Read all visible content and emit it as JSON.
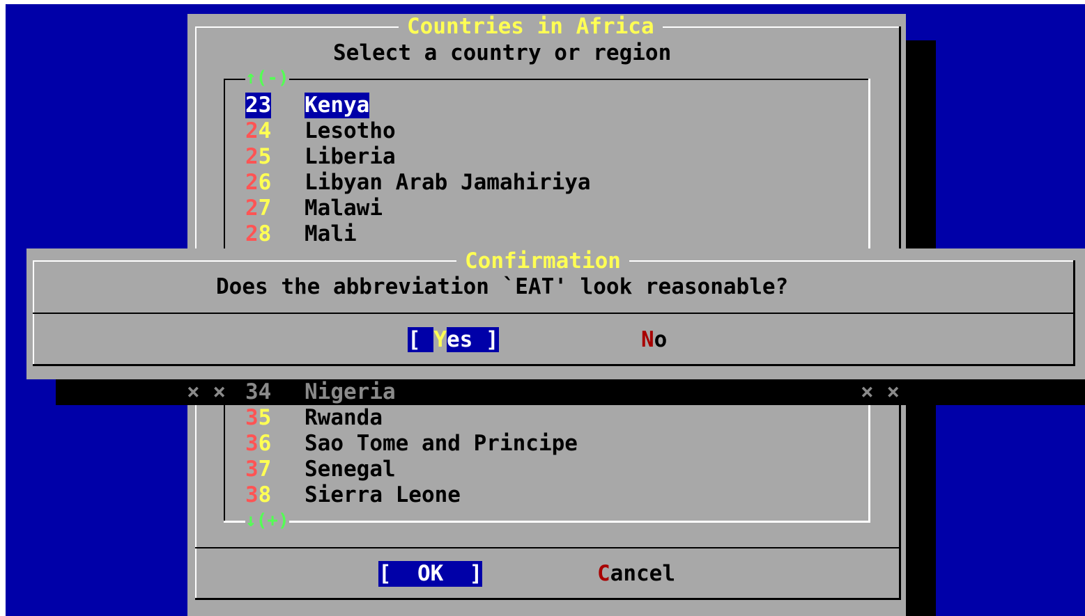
{
  "main_dialog": {
    "title": "Countries in Africa",
    "prompt": "Select a country or region",
    "scroll_up": "↑(-)",
    "scroll_down": "↓(+)",
    "items_top": [
      {
        "num": "23",
        "label": "Kenya"
      },
      {
        "num": "24",
        "label": "Lesotho"
      },
      {
        "num": "25",
        "label": "Liberia"
      },
      {
        "num": "26",
        "label": "Libyan Arab Jamahiriya"
      },
      {
        "num": "27",
        "label": "Malawi"
      },
      {
        "num": "28",
        "label": "Mali"
      }
    ],
    "shadowed_row": {
      "marks_left": "× ×",
      "num": "34",
      "label": "Nigeria",
      "marks_right": "× ×"
    },
    "items_bottom": [
      {
        "num": "35",
        "label": "Rwanda"
      },
      {
        "num": "36",
        "label": "Sao Tome and Principe"
      },
      {
        "num": "37",
        "label": "Senegal"
      },
      {
        "num": "38",
        "label": "Sierra Leone"
      }
    ],
    "ok_button": "[  OK  ]",
    "cancel_hotkey": "C",
    "cancel_rest": "ancel"
  },
  "confirm_dialog": {
    "title": "Confirmation",
    "question": "Does the abbreviation `EAT' look reasonable?",
    "yes_open": "[ ",
    "yes_key": "Y",
    "yes_rest": "es ]",
    "no_hotkey": "N",
    "no_rest": "o"
  }
}
